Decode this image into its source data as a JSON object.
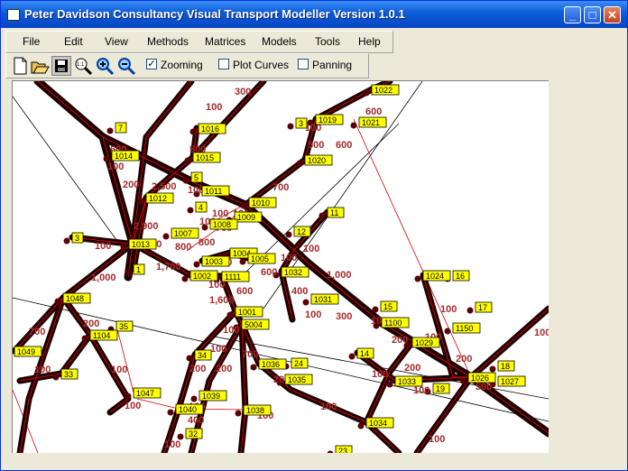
{
  "window": {
    "title": "Peter Davidson  Consultancy Visual Transport Modeller Version 1.0.1",
    "min_icon": "minimize-icon",
    "max_icon": "maximize-icon",
    "close_icon": "close-icon",
    "min_glyph": "_",
    "max_glyph": "□",
    "close_glyph": "✕"
  },
  "menu": [
    "File",
    "Edit",
    "View",
    "Methods",
    "Matrices",
    "Models",
    "Tools",
    "Help"
  ],
  "toolbar": {
    "icons": [
      "new-file-icon",
      "open-folder-icon",
      "save-disk-icon",
      "zoom-fit-icon",
      "zoom-in-icon",
      "zoom-out-icon"
    ],
    "zooming": {
      "label": "Zooming",
      "checked": true
    },
    "plot_curves": {
      "label": "Plot Curves",
      "checked": false
    },
    "panning": {
      "label": "Panning",
      "checked": false
    }
  },
  "colors": {
    "link_dark": "#1a0000",
    "link_red": "#d40000",
    "node_fill": "#ffff00",
    "value_text": "#a52a2a"
  },
  "map": {
    "nodes": [
      [
        "1022",
        410,
        97
      ],
      [
        "1019",
        348,
        130
      ],
      [
        "1021",
        396,
        133
      ],
      [
        "3",
        326,
        134
      ],
      [
        "7",
        126,
        139
      ],
      [
        "1016",
        218,
        140
      ],
      [
        "1020",
        336,
        175
      ],
      [
        "1014",
        122,
        170
      ],
      [
        "1015",
        212,
        172
      ],
      [
        "5",
        210,
        194
      ],
      [
        "1011",
        222,
        209
      ],
      [
        "1012",
        160,
        217
      ],
      [
        "4",
        215,
        227
      ],
      [
        "1010",
        274,
        222
      ],
      [
        "11",
        361,
        233
      ],
      [
        "1009",
        258,
        238
      ],
      [
        "1008",
        231,
        246
      ],
      [
        "12",
        324,
        254
      ],
      [
        "3",
        78,
        261
      ],
      [
        "1007",
        188,
        256
      ],
      [
        "1013",
        141,
        268
      ],
      [
        "1004",
        253,
        278
      ],
      [
        "1003",
        222,
        287
      ],
      [
        "1005",
        273,
        284
      ],
      [
        "1",
        146,
        296
      ],
      [
        "1002",
        209,
        303
      ],
      [
        "1111",
        244,
        304
      ],
      [
        "1032",
        310,
        299
      ],
      [
        "1024",
        467,
        303
      ],
      [
        "16",
        500,
        303
      ],
      [
        "1048",
        68,
        328
      ],
      [
        "1031",
        343,
        329
      ],
      [
        "15",
        420,
        337
      ],
      [
        "17",
        525,
        338
      ],
      [
        "1001",
        259,
        343
      ],
      [
        "5004",
        266,
        357
      ],
      [
        "1100",
        421,
        355
      ],
      [
        "1150",
        500,
        361
      ],
      [
        "35",
        127,
        359
      ],
      [
        "1104",
        98,
        369
      ],
      [
        "1049",
        14,
        387
      ],
      [
        "1029",
        455,
        377
      ],
      [
        "14",
        394,
        389
      ],
      [
        "34",
        214,
        391
      ],
      [
        "1036",
        285,
        401
      ],
      [
        "24",
        321,
        400
      ],
      [
        "1026",
        517,
        416
      ],
      [
        "18",
        550,
        403
      ],
      [
        "1035",
        314,
        418
      ],
      [
        "1033",
        436,
        420
      ],
      [
        "1027",
        550,
        420
      ],
      [
        "33",
        66,
        412
      ],
      [
        "19",
        478,
        428
      ],
      [
        "1047",
        146,
        433
      ],
      [
        "1039",
        219,
        436
      ],
      [
        "1040",
        193,
        451
      ],
      [
        "1038",
        268,
        452
      ],
      [
        "1034",
        404,
        466
      ],
      [
        "32",
        204,
        478
      ],
      [
        "23",
        370,
        497
      ]
    ],
    "values": [
      [
        "300",
        258,
        103
      ],
      [
        "100",
        226,
        120
      ],
      [
        "600",
        403,
        125
      ],
      [
        "100",
        336,
        143
      ],
      [
        "500",
        339,
        162
      ],
      [
        "600",
        370,
        162
      ],
      [
        "600",
        120,
        167
      ],
      [
        "100",
        117,
        186
      ],
      [
        "500",
        208,
        167
      ],
      [
        "200",
        134,
        206
      ],
      [
        "2,500",
        166,
        208
      ],
      [
        "100",
        206,
        212
      ],
      [
        "700",
        300,
        209
      ],
      [
        "100",
        219,
        247
      ],
      [
        "100",
        233,
        238
      ],
      [
        "700",
        237,
        254
      ],
      [
        "100",
        256,
        238
      ],
      [
        "2,900",
        146,
        252
      ],
      [
        "500",
        159,
        272
      ],
      [
        "800",
        192,
        275
      ],
      [
        "800",
        218,
        270
      ],
      [
        "100",
        103,
        274
      ],
      [
        "1,000",
        99,
        309
      ],
      [
        "1,700",
        171,
        297
      ],
      [
        "500",
        237,
        292
      ],
      [
        "600",
        287,
        303
      ],
      [
        "100",
        309,
        287
      ],
      [
        "100",
        334,
        277
      ],
      [
        "1,000",
        360,
        306
      ],
      [
        "400",
        321,
        324
      ],
      [
        "100",
        229,
        317
      ],
      [
        "600",
        260,
        324
      ],
      [
        "1,600",
        230,
        334
      ],
      [
        "100",
        336,
        350
      ],
      [
        "300",
        370,
        352
      ],
      [
        "100",
        409,
        357
      ],
      [
        "100",
        486,
        344
      ],
      [
        "200",
        90,
        360
      ],
      [
        "700",
        30,
        369
      ],
      [
        "100",
        245,
        367
      ],
      [
        "200",
        432,
        378
      ],
      [
        "100",
        36,
        411
      ],
      [
        "100",
        231,
        388
      ],
      [
        "700",
        266,
        394
      ],
      [
        "100",
        469,
        375
      ],
      [
        "200",
        208,
        410
      ],
      [
        "200",
        237,
        410
      ],
      [
        "200",
        503,
        399
      ],
      [
        "200",
        446,
        409
      ],
      [
        "100",
        121,
        411
      ],
      [
        "200",
        301,
        422
      ],
      [
        "100",
        410,
        416
      ],
      [
        "500",
        525,
        430
      ],
      [
        "100",
        456,
        434
      ],
      [
        "100",
        136,
        451
      ],
      [
        "100",
        207,
        452
      ],
      [
        "100",
        353,
        452
      ],
      [
        "100",
        283,
        462
      ],
      [
        "400",
        206,
        467
      ],
      [
        "100",
        473,
        488
      ],
      [
        "100",
        180,
        494
      ],
      [
        "100",
        590,
        370
      ]
    ]
  }
}
